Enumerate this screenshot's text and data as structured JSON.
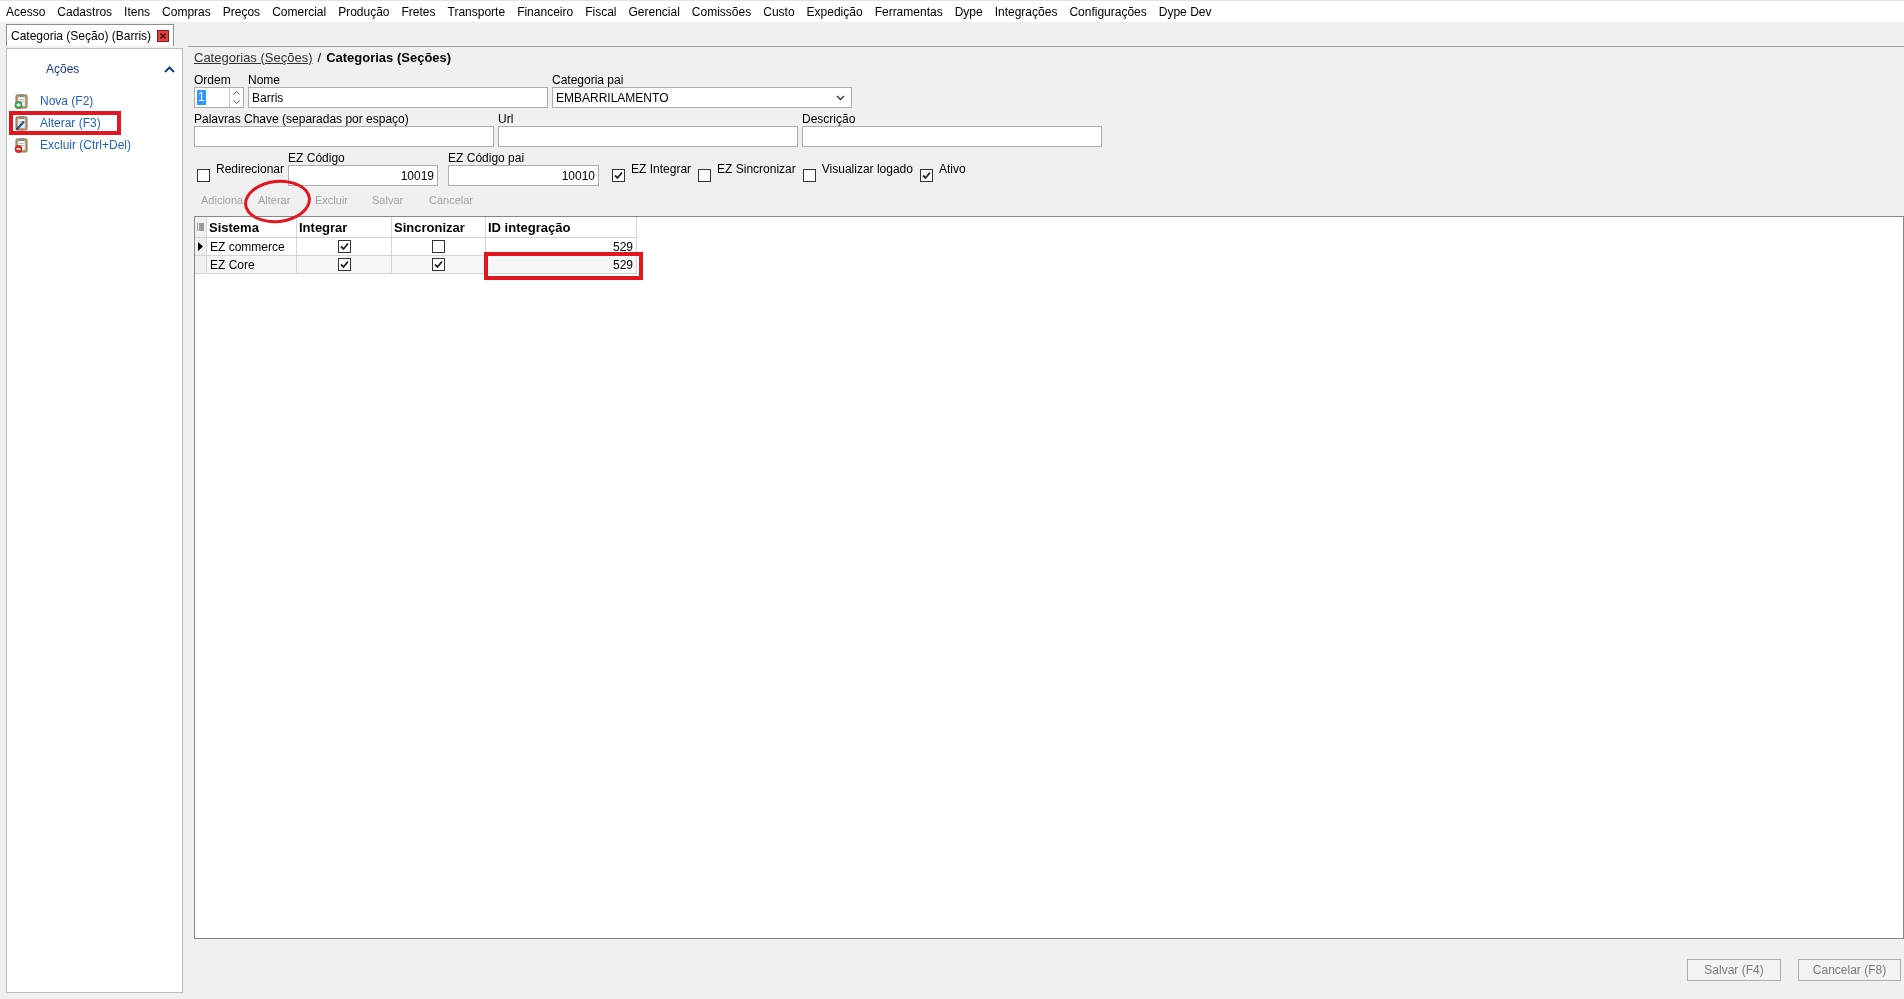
{
  "menu": [
    "Acesso",
    "Cadastros",
    "Itens",
    "Compras",
    "Preços",
    "Comercial",
    "Produção",
    "Fretes",
    "Transporte",
    "Financeiro",
    "Fiscal",
    "Gerencial",
    "Comissões",
    "Custo",
    "Expedição",
    "Ferramentas",
    "Dype",
    "Integrações",
    "Configurações",
    "Dype Dev"
  ],
  "document_tabs": [
    {
      "label": "Categoria (Seção) (Barris)",
      "selected": true
    }
  ],
  "sidebar": {
    "title": "Ações",
    "expanded": true,
    "actions": [
      {
        "kind": "new",
        "label": "Nova (F2)",
        "boxed": false
      },
      {
        "kind": "edit",
        "label": "Alterar (F3)",
        "boxed": true
      },
      {
        "kind": "delete",
        "label": "Excluir (Ctrl+Del)",
        "boxed": false
      }
    ]
  },
  "breadcrumb": {
    "link": "Categorias (Seções)",
    "separator": "/",
    "current": "Categorias (Seções)"
  },
  "form": {
    "main_fields": [
      {
        "kind": "spinner",
        "label": "Ordem",
        "value": "1",
        "text_selected": true
      },
      {
        "kind": "text",
        "label": "Nome",
        "value": "Barris"
      },
      {
        "kind": "combo",
        "label": "Categoria pai",
        "value": "EMBARRILAMENTO"
      }
    ],
    "web_fields": [
      {
        "kind": "text",
        "label": "Palavras Chave (separadas por espaço)"
      },
      {
        "kind": "text",
        "label": "Url"
      },
      {
        "kind": "text",
        "label": "Descrição"
      }
    ],
    "integration_fields": [
      {
        "kind": "check",
        "label": "Redirecionar",
        "checked": false
      },
      {
        "kind": "number",
        "label": "EZ Código",
        "value": "10019"
      },
      {
        "kind": "number",
        "label": "EZ Código pai",
        "value": "10010"
      },
      {
        "kind": "check",
        "label": "EZ Integrar",
        "checked": true
      },
      {
        "kind": "check",
        "label": "EZ Sincronizar",
        "checked": false
      },
      {
        "kind": "check",
        "label": "Visualizar logado",
        "checked": false
      },
      {
        "kind": "check",
        "label": "Ativo",
        "checked": true
      }
    ]
  },
  "toolbar": [
    {
      "label": "Adiciona",
      "disabled": true,
      "circled": false
    },
    {
      "label": "Alterar",
      "disabled": true,
      "circled": true
    },
    {
      "label": "Excluir",
      "disabled": true,
      "circled": false
    },
    {
      "label": "Salvar",
      "disabled": true,
      "circled": false
    },
    {
      "label": "Cancelar",
      "disabled": true,
      "circled": false
    }
  ],
  "grid": {
    "columns": [
      "Sistema",
      "Integrar",
      "Sincronizar",
      "ID integração"
    ],
    "rows": [
      {
        "selected": true,
        "sistema": "EZ commerce",
        "integrar": true,
        "sincronizar": false,
        "id_integracao": "529",
        "id_boxed": false
      },
      {
        "selected": false,
        "sistema": "EZ Core",
        "integrar": true,
        "sincronizar": true,
        "id_integracao": "529",
        "id_boxed": true
      }
    ]
  },
  "footer_buttons": [
    {
      "label": "Salvar (F4)",
      "disabled": true
    },
    {
      "label": "Cancelar (F8)",
      "disabled": true
    }
  ]
}
